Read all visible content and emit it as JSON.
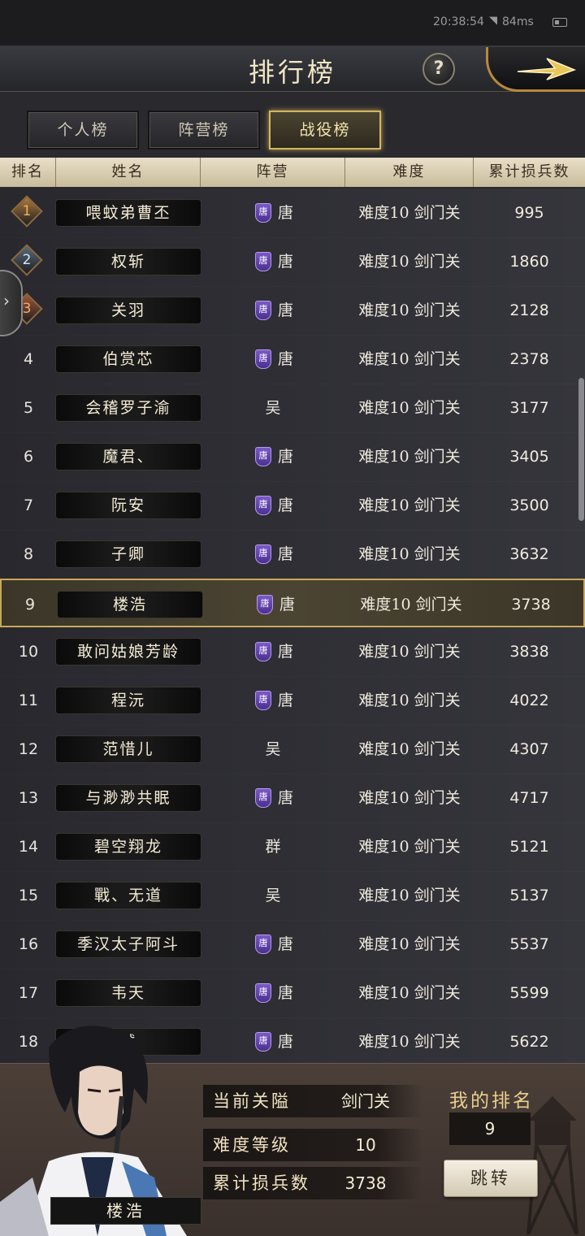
{
  "status_bar": {
    "time": "20:38:54",
    "ping": "84ms"
  },
  "header": {
    "title": "排行榜",
    "help_label": "?"
  },
  "tabs": [
    {
      "label": "个人榜",
      "active": false
    },
    {
      "label": "阵营榜",
      "active": false
    },
    {
      "label": "战役榜",
      "active": true
    }
  ],
  "table": {
    "columns": [
      "排名",
      "姓名",
      "阵营",
      "难度",
      "累计损兵数"
    ],
    "rows": [
      {
        "rank": "1",
        "name": "喂蚊弟曹丕",
        "faction": "唐",
        "faction_badge": "唐",
        "difficulty": "难度10 剑门关",
        "losses": "995"
      },
      {
        "rank": "2",
        "name": "权斩",
        "faction": "唐",
        "faction_badge": "唐",
        "difficulty": "难度10 剑门关",
        "losses": "1860"
      },
      {
        "rank": "3",
        "name": "关羽",
        "faction": "唐",
        "faction_badge": "唐",
        "difficulty": "难度10 剑门关",
        "losses": "2128"
      },
      {
        "rank": "4",
        "name": "伯赏芯",
        "faction": "唐",
        "faction_badge": "唐",
        "difficulty": "难度10 剑门关",
        "losses": "2378"
      },
      {
        "rank": "5",
        "name": "会稽罗子渝",
        "faction": "吴",
        "faction_badge": null,
        "difficulty": "难度10 剑门关",
        "losses": "3177"
      },
      {
        "rank": "6",
        "name": "魔君、",
        "faction": "唐",
        "faction_badge": "唐",
        "difficulty": "难度10 剑门关",
        "losses": "3405"
      },
      {
        "rank": "7",
        "name": "阮安",
        "faction": "唐",
        "faction_badge": "唐",
        "difficulty": "难度10 剑门关",
        "losses": "3500"
      },
      {
        "rank": "8",
        "name": "子卿",
        "faction": "唐",
        "faction_badge": "唐",
        "difficulty": "难度10 剑门关",
        "losses": "3632"
      },
      {
        "rank": "9",
        "name": "楼浩",
        "faction": "唐",
        "faction_badge": "唐",
        "difficulty": "难度10 剑门关",
        "losses": "3738",
        "highlight": true
      },
      {
        "rank": "10",
        "name": "敢问姑娘芳龄",
        "faction": "唐",
        "faction_badge": "唐",
        "difficulty": "难度10 剑门关",
        "losses": "3838"
      },
      {
        "rank": "11",
        "name": "程沅",
        "faction": "唐",
        "faction_badge": "唐",
        "difficulty": "难度10 剑门关",
        "losses": "4022"
      },
      {
        "rank": "12",
        "name": "范惜儿",
        "faction": "吴",
        "faction_badge": null,
        "difficulty": "难度10 剑门关",
        "losses": "4307"
      },
      {
        "rank": "13",
        "name": "与渺渺共眠",
        "faction": "唐",
        "faction_badge": "唐",
        "difficulty": "难度10 剑门关",
        "losses": "4717"
      },
      {
        "rank": "14",
        "name": "碧空翔龙",
        "faction": "群",
        "faction_badge": null,
        "difficulty": "难度10 剑门关",
        "losses": "5121"
      },
      {
        "rank": "15",
        "name": "戰、无道",
        "faction": "吴",
        "faction_badge": null,
        "difficulty": "难度10 剑门关",
        "losses": "5137"
      },
      {
        "rank": "16",
        "name": "季汉太子阿斗",
        "faction": "唐",
        "faction_badge": "唐",
        "difficulty": "难度10 剑门关",
        "losses": "5537"
      },
      {
        "rank": "17",
        "name": "韦天",
        "faction": "唐",
        "faction_badge": "唐",
        "difficulty": "难度10 剑门关",
        "losses": "5599"
      },
      {
        "rank": "18",
        "name": "慭",
        "faction": "唐",
        "faction_badge": "唐",
        "difficulty": "难度10 剑门关",
        "losses": "5622"
      }
    ]
  },
  "bottom_panel": {
    "hero_name": "楼浩",
    "current_pass_label": "当前关隘",
    "current_pass_value": "剑门关",
    "difficulty_label": "难度等级",
    "difficulty_value": "10",
    "losses_label": "累计损兵数",
    "losses_value": "3738",
    "my_rank_label": "我的排名",
    "my_rank_value": "9",
    "jump_label": "跳转"
  },
  "colors": {
    "accent_gold": "#c9a95a",
    "faction_shield": "#6a4cbf",
    "medal_1": "#b07a3a",
    "medal_2": "#5a6a7a",
    "medal_3": "#a0563a"
  }
}
